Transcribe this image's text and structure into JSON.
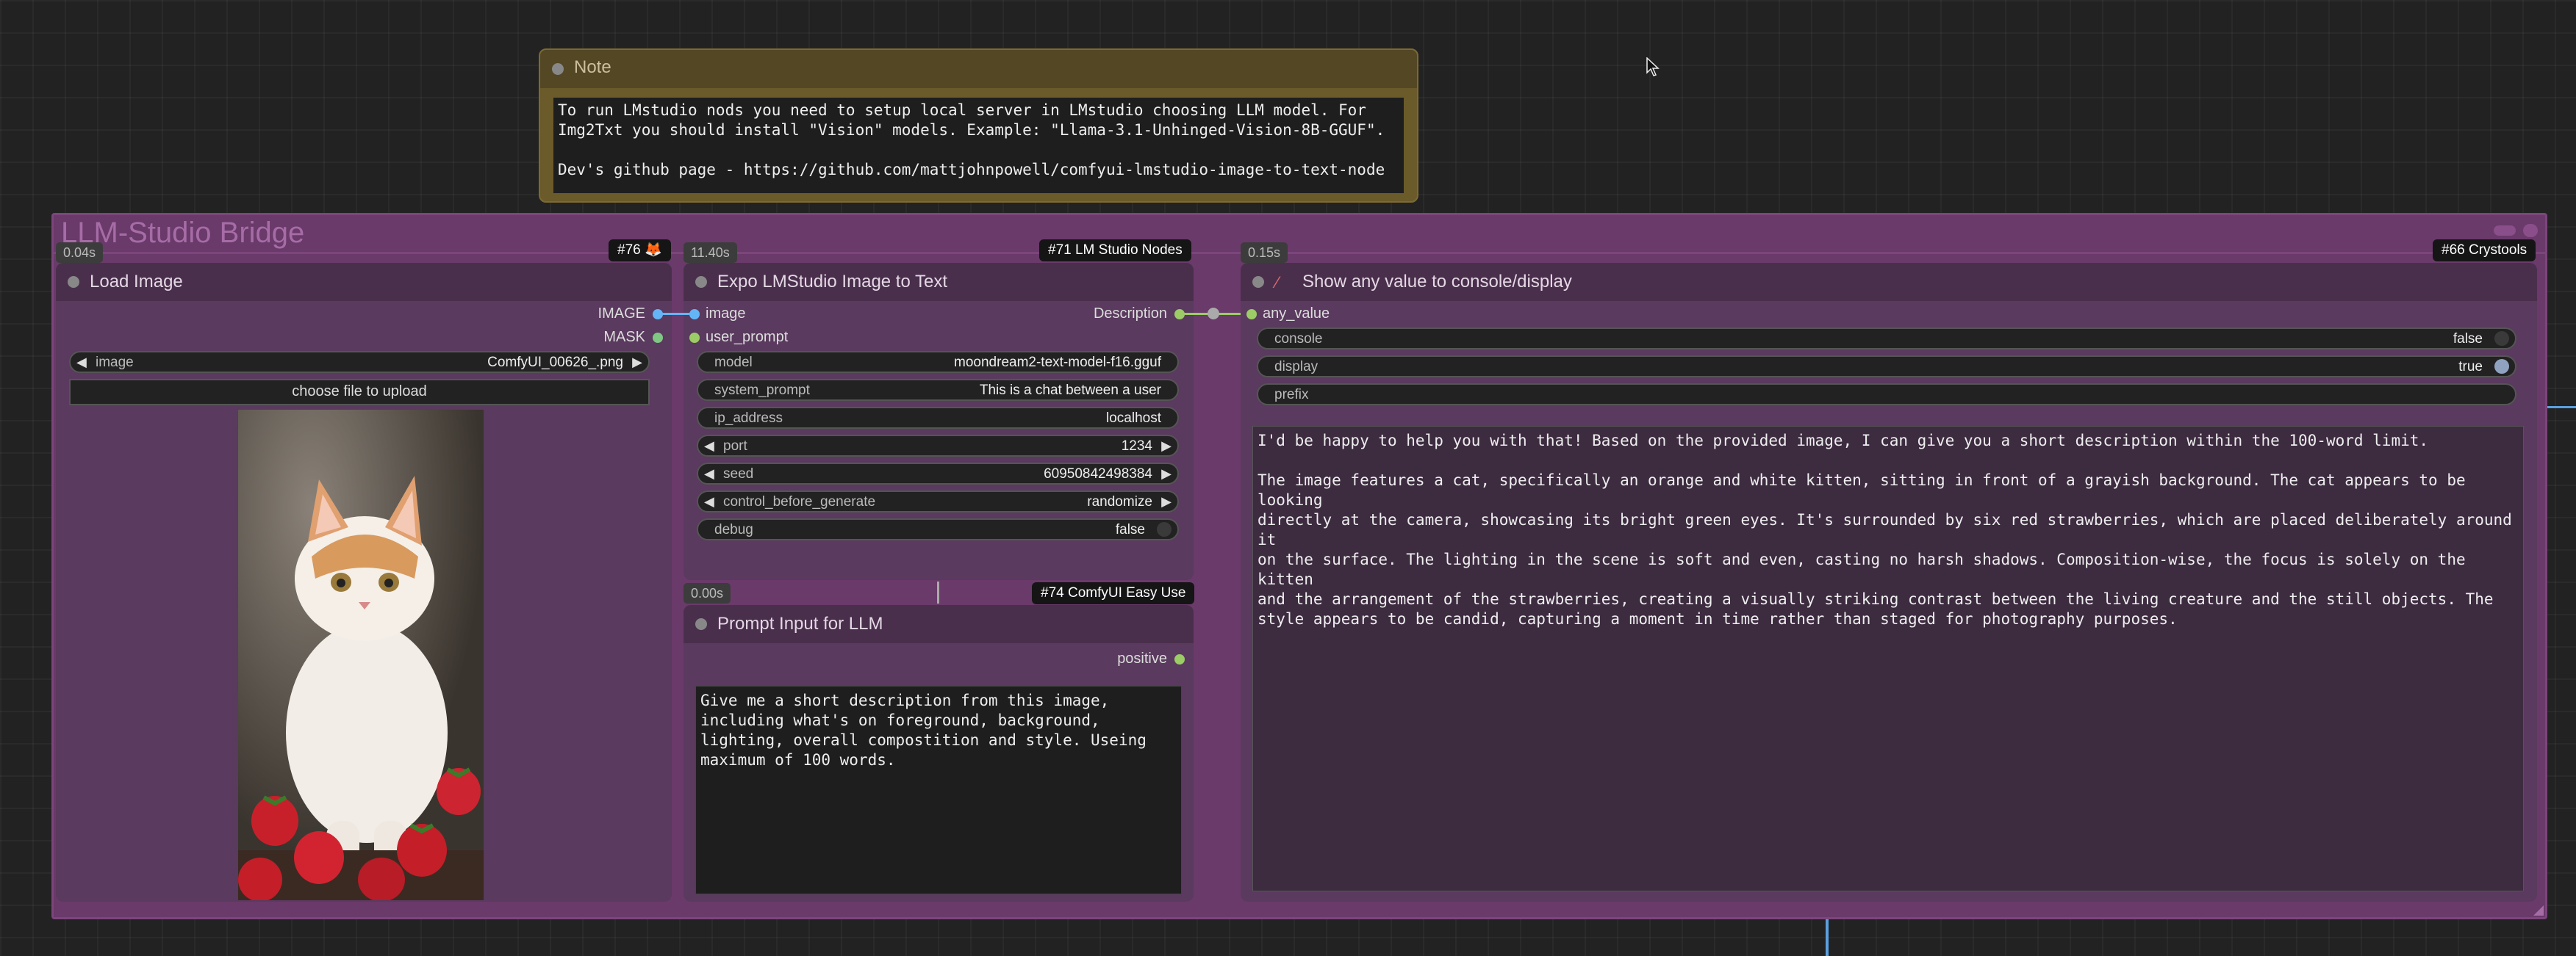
{
  "note": {
    "title": "Note",
    "text": "To run LMstudio nods you need to setup local server in LMstudio choosing LLM model. For\nImg2Txt you should install \"Vision\" models. Example: \"Llama-3.1-Unhinged-Vision-8B-GGUF\".\n\nDev's github page - https://github.com/mattjohnpowell/comfyui-lmstudio-image-to-text-node"
  },
  "group": {
    "title": "LLM-Studio Bridge"
  },
  "load_image": {
    "title": "Load Image",
    "time": "0.04s",
    "badge": "#76 🦊",
    "outputs": [
      "IMAGE",
      "MASK"
    ],
    "image_widget": {
      "label": "image",
      "value": "ComfyUI_00626_.png"
    },
    "upload_label": "choose file to upload"
  },
  "expo": {
    "title": "Expo LMStudio Image to Text",
    "time": "11.40s",
    "badge": "#71 LM Studio Nodes",
    "inputs": [
      "image",
      "user_prompt"
    ],
    "output": "Description",
    "widgets": {
      "model": {
        "label": "model",
        "value": "moondream2-text-model-f16.gguf"
      },
      "system_prompt": {
        "label": "system_prompt",
        "value": "This is a chat between a user"
      },
      "ip_address": {
        "label": "ip_address",
        "value": "localhost"
      },
      "port": {
        "label": "port",
        "value": "1234"
      },
      "seed": {
        "label": "seed",
        "value": "60950842498384"
      },
      "control": {
        "label": "control_before_generate",
        "value": "randomize"
      },
      "debug": {
        "label": "debug",
        "value": "false"
      }
    }
  },
  "prompt_input": {
    "title": "Prompt Input for LLM",
    "time": "0.00s",
    "badge": "#74 ComfyUI Easy Use",
    "output": "positive",
    "text": "Give me a short description from this image,\nincluding what's on foreground, background,\nlighting, overall compostition and style. Useing\nmaximum of 100 words."
  },
  "show_any": {
    "title": "Show any value to console/display",
    "time": "0.15s",
    "badge": "#66 Crystools",
    "input": "any_value",
    "widgets": {
      "console": {
        "label": "console",
        "value": "false"
      },
      "display": {
        "label": "display",
        "value": "true"
      },
      "prefix": {
        "label": "prefix",
        "value": ""
      }
    },
    "text": "I'd be happy to help you with that! Based on the provided image, I can give you a short description within the 100-word limit.\n\nThe image features a cat, specifically an orange and white kitten, sitting in front of a grayish background. The cat appears to be looking\ndirectly at the camera, showcasing its bright green eyes. It's surrounded by six red strawberries, which are placed deliberately around it\non the surface. The lighting in the scene is soft and even, casting no harsh shadows. Composition-wise, the focus is solely on the kitten\nand the arrangement of the strawberries, creating a visually striking contrast between the living creature and the still objects. The\nstyle appears to be candid, capturing a moment in time rather than staged for photography purposes."
  },
  "colors": {
    "image_slot": "#64b5f6",
    "mask_slot": "#81c784",
    "string_slot": "#9ccc65",
    "link": "#5aa0e0"
  }
}
